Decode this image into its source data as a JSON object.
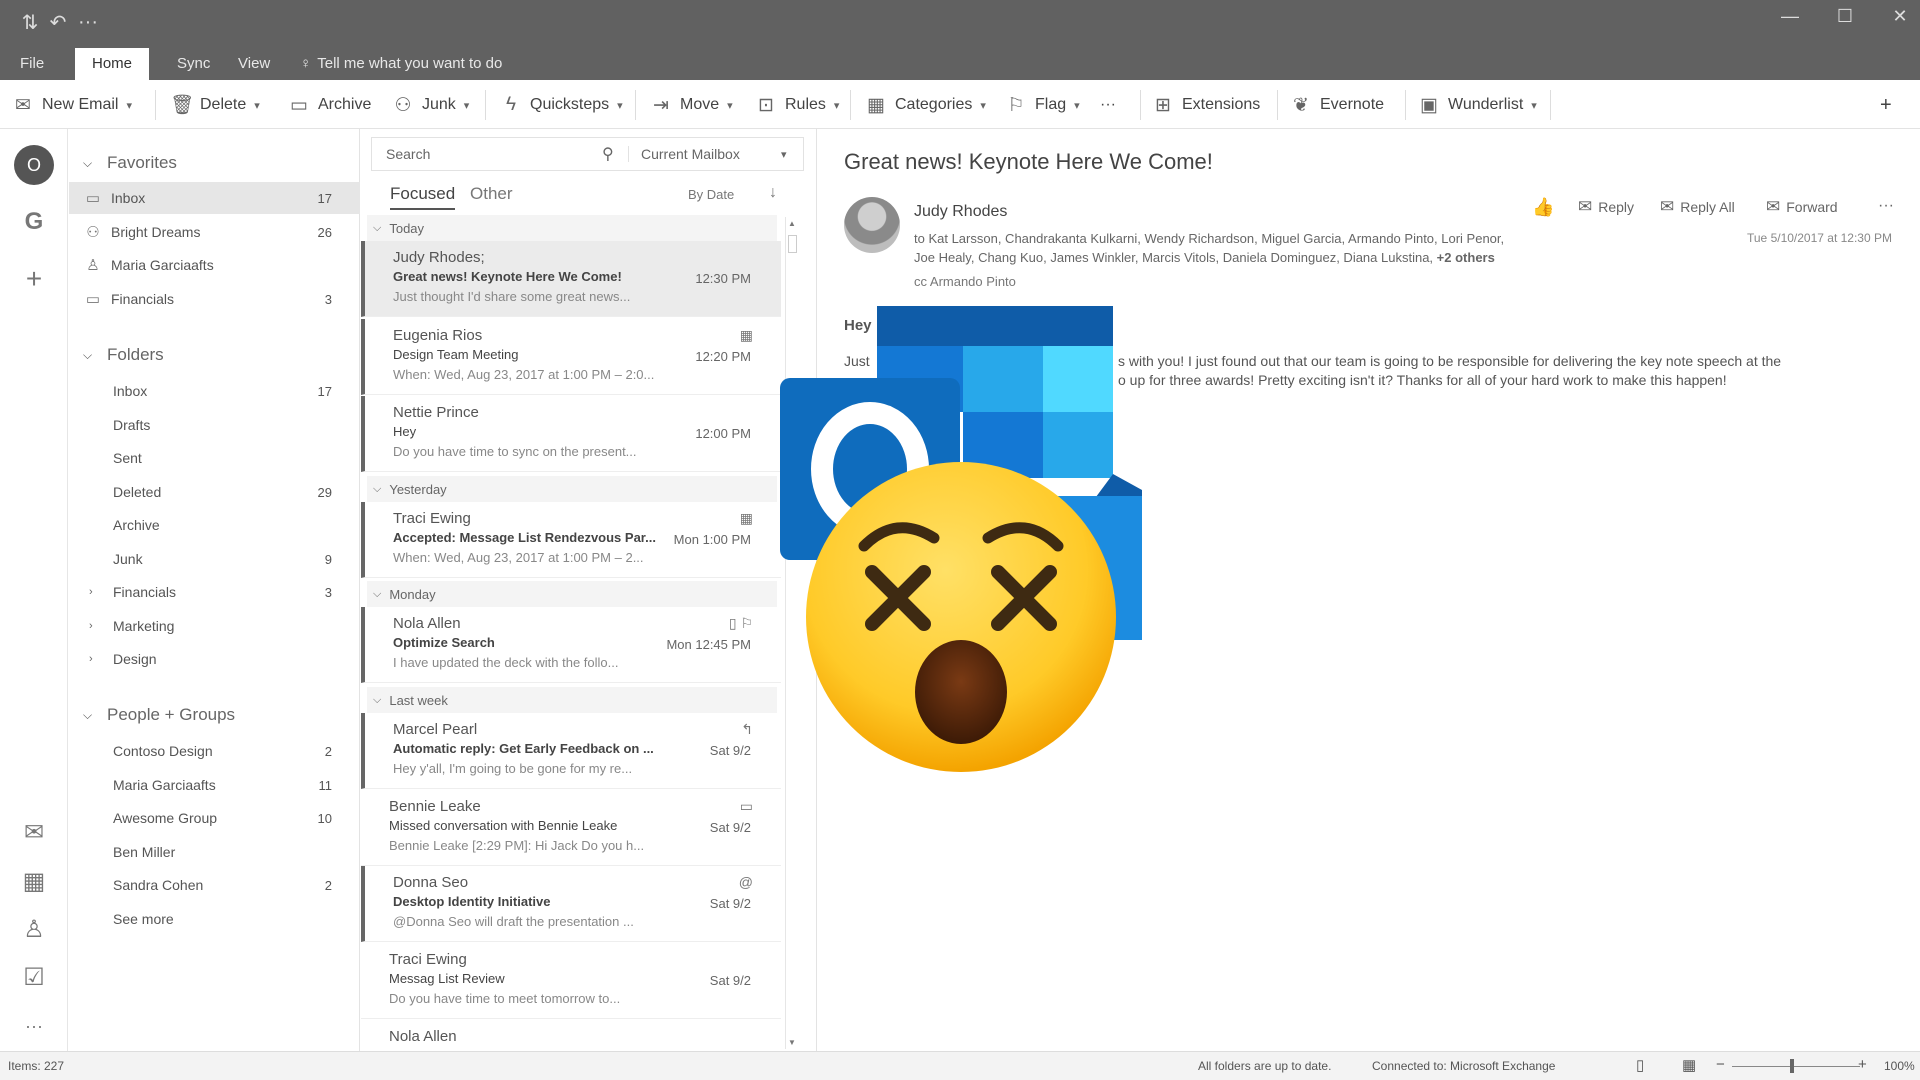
{
  "titlebar": {
    "menu_tabs": [
      "File",
      "Home",
      "Sync",
      "View"
    ],
    "active_tab": "Home",
    "tell_me": "Tell me what you want to do"
  },
  "ribbon": {
    "new_email": "New Email",
    "delete": "Delete",
    "archive": "Archive",
    "junk": "Junk",
    "quicksteps": "Quicksteps",
    "move": "Move",
    "rules": "Rules",
    "categories": "Categories",
    "flag": "Flag",
    "more": "···",
    "extensions": "Extensions",
    "evernote": "Evernote",
    "wunderlist": "Wunderlist",
    "add": "+"
  },
  "rail": {
    "more": "···"
  },
  "favorites": {
    "header": "Favorites",
    "items": [
      {
        "name": "Inbox",
        "count": "17"
      },
      {
        "name": "Bright Dreams",
        "count": "26"
      },
      {
        "name": "Maria Garciaafts",
        "count": ""
      },
      {
        "name": "Financials",
        "count": "3"
      }
    ]
  },
  "folders": {
    "header": "Folders",
    "items": [
      {
        "name": "Inbox",
        "count": "17"
      },
      {
        "name": "Drafts",
        "count": ""
      },
      {
        "name": "Sent",
        "count": ""
      },
      {
        "name": "Deleted",
        "count": "29"
      },
      {
        "name": "Archive",
        "count": ""
      },
      {
        "name": "Junk",
        "count": "9"
      },
      {
        "name": "Financials",
        "count": "3"
      },
      {
        "name": "Marketing",
        "count": ""
      },
      {
        "name": "Design",
        "count": ""
      }
    ]
  },
  "groups": {
    "header": "People + Groups",
    "items": [
      {
        "name": "Contoso Design",
        "count": "2"
      },
      {
        "name": "Maria Garciaafts",
        "count": "11"
      },
      {
        "name": "Awesome Group",
        "count": "10"
      },
      {
        "name": "Ben Miller",
        "count": ""
      },
      {
        "name": "Sandra Cohen",
        "count": "2"
      },
      {
        "name": "See more",
        "count": ""
      }
    ]
  },
  "messagelist": {
    "search_placeholder": "Search",
    "scope": "Current Mailbox",
    "tab_focused": "Focused",
    "tab_other": "Other",
    "sort": "By Date",
    "groups": [
      "Today",
      "Yesterday",
      "Monday",
      "Last week"
    ],
    "messages": [
      {
        "from": "Judy Rhodes;",
        "subject": "Great news! Keynote Here We Come!",
        "preview": "Just thought I'd share some great news...",
        "time": "12:30 PM",
        "icon": ""
      },
      {
        "from": "Eugenia Rios",
        "subject": "Design Team Meeting",
        "preview": "When: Wed, Aug 23, 2017 at 1:00 PM – 2:0...",
        "time": "12:20 PM",
        "icon": "calendar-icon"
      },
      {
        "from": "Nettie Prince",
        "subject": "Hey",
        "preview": "Do you have time to sync on the present...",
        "time": "12:00 PM",
        "icon": ""
      },
      {
        "from": "Traci Ewing",
        "subject": "Accepted: Message List Rendezvous Par...",
        "preview": "When: Wed, Aug 23, 2017 at 1:00 PM – 2...",
        "time": "Mon 1:00 PM",
        "icon": "calendar-icon"
      },
      {
        "from": "Nola Allen",
        "subject": "Optimize Search",
        "preview": "I have updated the deck with the follo...",
        "time": "Mon 12:45 PM",
        "icon": "flag-icon"
      },
      {
        "from": "Marcel Pearl",
        "subject": "Automatic reply: Get Early Feedback on ...",
        "preview": "Hey y'all, I'm going to be gone for my re...",
        "time": "Sat 9/2",
        "icon": "reply-icon"
      },
      {
        "from": "Bennie Leake",
        "subject": "Missed conversation with Bennie Leake",
        "preview": "Bennie Leake [2:29 PM]: Hi Jack Do you h...",
        "time": "Sat 9/2",
        "icon": "chat-icon"
      },
      {
        "from": "Donna Seo",
        "subject": "Desktop Identity Initiative",
        "preview": "@Donna Seo will draft the presentation ...",
        "time": "Sat 9/2",
        "icon": "mention-icon"
      },
      {
        "from": "Traci Ewing",
        "subject": "Messag List Review",
        "preview": "Do you have time to meet tomorrow to...",
        "time": "Sat 9/2",
        "icon": ""
      },
      {
        "from": "Nola Allen",
        "subject": "",
        "preview": "",
        "time": "",
        "icon": ""
      }
    ]
  },
  "reading": {
    "subject": "Great news! Keynote Here We Come!",
    "sender": "Judy Rhodes",
    "to_line": "to Kat Larsson, Chandrakanta Kulkarni, Wendy Richardson, Miguel Garcia, Armando Pinto, Lori Penor,",
    "to_line2": "Joe Healy, Chang Kuo, James Winkler, Marcis Vitols, Daniela Dominguez, Diana Lukstina,",
    "others": "+2 others",
    "cc": "cc Armando Pinto",
    "date": "Tue 5/10/2017 at 12:30 PM",
    "reply": "Reply",
    "reply_all": "Reply All",
    "forward": "Forward",
    "greeting": "Hey",
    "body_start": "Just",
    "body_line1": "s with you! I just found out that our team is going to be responsible for delivering the key note speech at the",
    "body_line2": "o up for three awards! Pretty exciting isn't it? Thanks for all of your hard work to make this happen!"
  },
  "status": {
    "items": "Items: 227",
    "sync": "All folders are up to date.",
    "connection": "Connected to: Microsoft Exchange",
    "zoom": "100%"
  },
  "colors": {
    "logo_dark": "#0f5ca8",
    "logo_blue": "#1478d4",
    "logo_light": "#28a8ea",
    "logo_cyan": "#50d9ff",
    "emoji_yellow": "#ffca28"
  },
  "overlay": {
    "logo": "outlook-logo",
    "emoji": "dizzy-face-emoji"
  }
}
